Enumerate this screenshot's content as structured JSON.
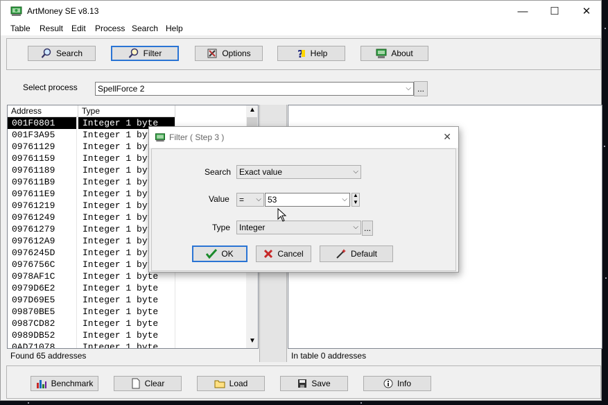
{
  "window": {
    "title": "ArtMoney SE v8.13",
    "minimize": "—",
    "maximize": "☐",
    "close": "✕"
  },
  "menu": [
    "Table",
    "Result",
    "Edit",
    "Process",
    "Search",
    "Help"
  ],
  "toolbar": {
    "search": "Search",
    "filter": "Filter",
    "options": "Options",
    "help": "Help",
    "about": "About"
  },
  "process": {
    "label": "Select process",
    "value": "SpellForce 2",
    "browse": "..."
  },
  "results": {
    "columns": [
      "Address",
      "Type"
    ],
    "rows": [
      {
        "address": "001F0801",
        "type": "Integer 1 byte"
      },
      {
        "address": "001F3A95",
        "type": "Integer 1 byte"
      },
      {
        "address": "09761129",
        "type": "Integer 1 byte"
      },
      {
        "address": "09761159",
        "type": "Integer 1 byte"
      },
      {
        "address": "09761189",
        "type": "Integer 1 byte"
      },
      {
        "address": "097611B9",
        "type": "Integer 1 byte"
      },
      {
        "address": "097611E9",
        "type": "Integer 1 byte"
      },
      {
        "address": "09761219",
        "type": "Integer 1 byte"
      },
      {
        "address": "09761249",
        "type": "Integer 1 byte"
      },
      {
        "address": "09761279",
        "type": "Integer 1 byte"
      },
      {
        "address": "097612A9",
        "type": "Integer 1 byte"
      },
      {
        "address": "0976245D",
        "type": "Integer 1 byte"
      },
      {
        "address": "0976756C",
        "type": "Integer 1 byte"
      },
      {
        "address": "0978AF1C",
        "type": "Integer 1 byte"
      },
      {
        "address": "0979D6E2",
        "type": "Integer 1 byte"
      },
      {
        "address": "097D69E5",
        "type": "Integer 1 byte"
      },
      {
        "address": "09870BE5",
        "type": "Integer 1 byte"
      },
      {
        "address": "0987CD82",
        "type": "Integer 1 byte"
      },
      {
        "address": "0989DB52",
        "type": "Integer 1 byte"
      },
      {
        "address": "0AD71078",
        "type": "Integer 1 byte"
      }
    ],
    "status": "Found 65 addresses"
  },
  "table": {
    "status": "In table 0 addresses"
  },
  "bottom": {
    "benchmark": "Benchmark",
    "clear": "Clear",
    "load": "Load",
    "save": "Save",
    "info": "Info"
  },
  "dialog": {
    "title": "Filter ( Step 3 )",
    "close": "✕",
    "search_label": "Search",
    "search_value": "Exact value",
    "value_label": "Value",
    "operator": "=",
    "value": "53",
    "type_label": "Type",
    "type_value": "Integer",
    "type_browse": "...",
    "ok": "OK",
    "cancel": "Cancel",
    "default": "Default"
  }
}
